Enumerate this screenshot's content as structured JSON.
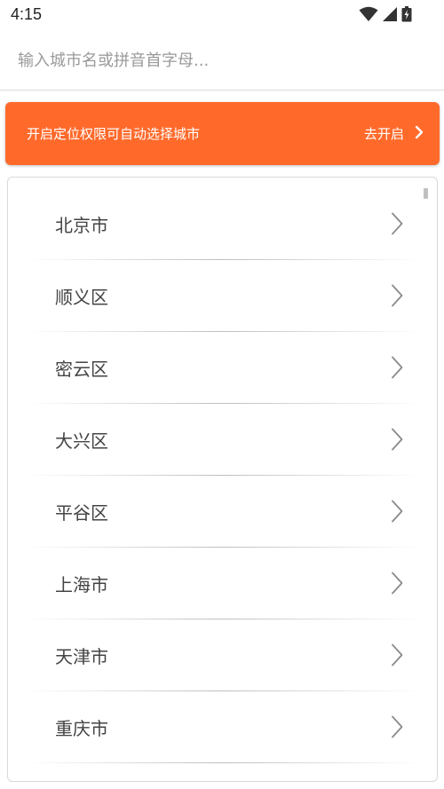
{
  "status_bar": {
    "time": "4:15",
    "icons": [
      "wifi-icon",
      "signal-icon",
      "battery-icon"
    ]
  },
  "search": {
    "placeholder": "输入城市名或拼音首字母...",
    "value": ""
  },
  "location_banner": {
    "message": "开启定位权限可自动选择城市",
    "action_label": "去开启",
    "action_icon": "chevron-right-icon",
    "background_color": "#ff6a2b"
  },
  "city_list": {
    "items": [
      {
        "name": "北京市"
      },
      {
        "name": "顺义区"
      },
      {
        "name": "密云区"
      },
      {
        "name": "大兴区"
      },
      {
        "name": "平谷区"
      },
      {
        "name": "上海市"
      },
      {
        "name": "天津市"
      },
      {
        "name": "重庆市"
      }
    ],
    "item_icon": "chevron-right-icon"
  }
}
